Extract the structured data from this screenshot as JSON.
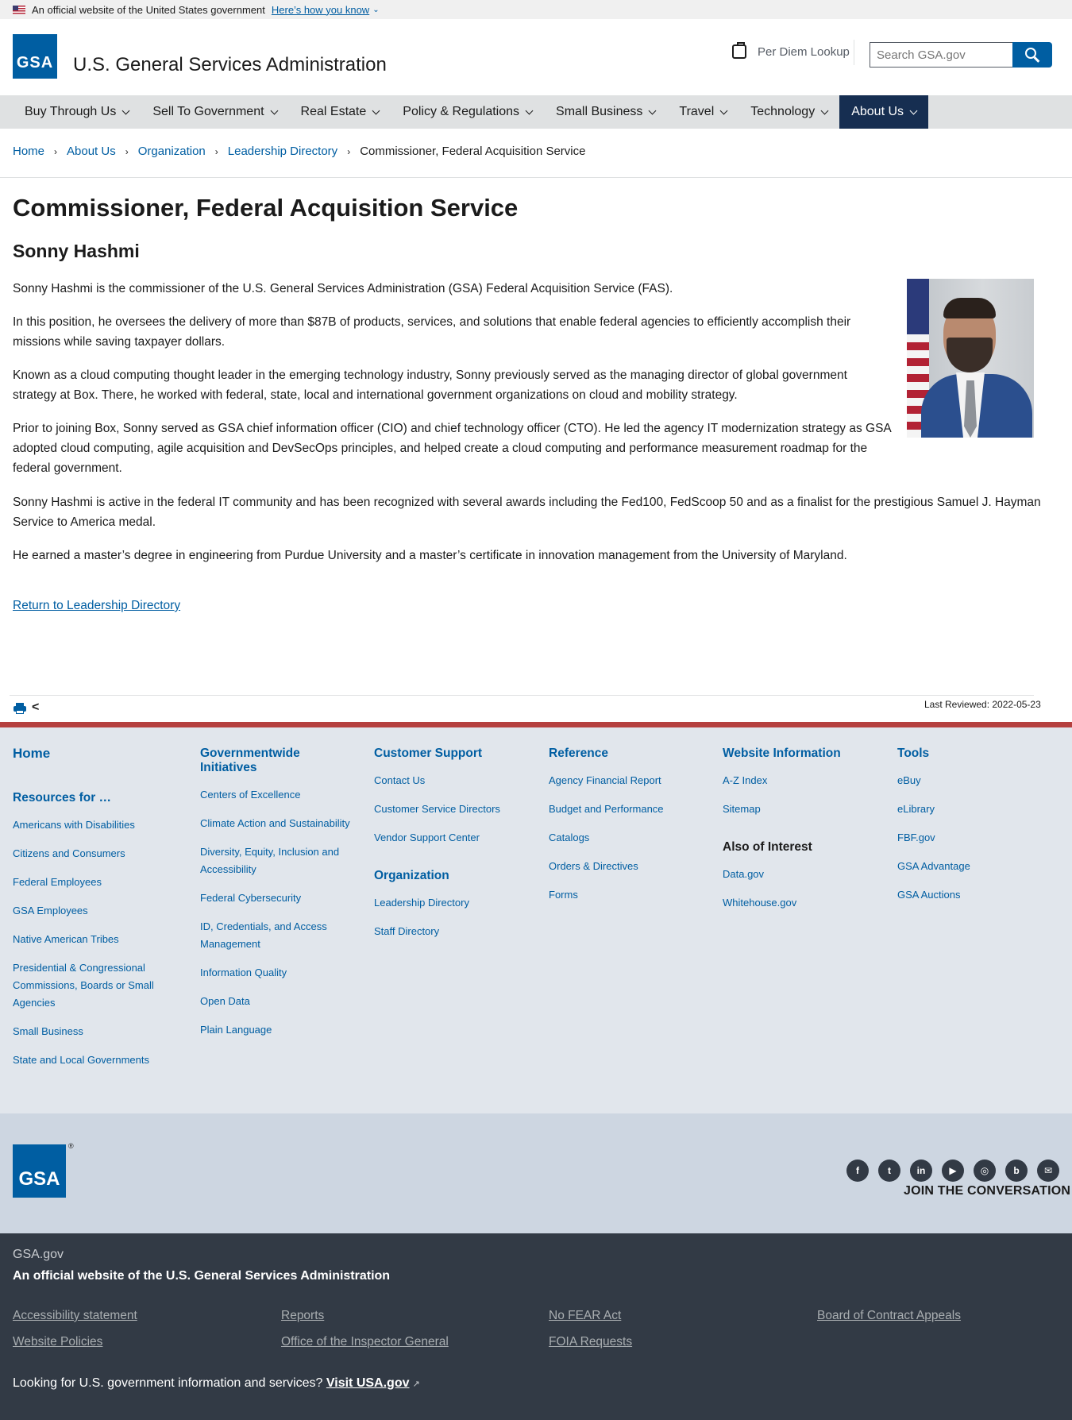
{
  "banner": {
    "text": "An official website of the United States government",
    "how_link": "Here’s how you know"
  },
  "header": {
    "logo": "GSA",
    "title": "U.S. General Services Administration",
    "per_diem": "Per Diem Lookup",
    "search_placeholder": "Search GSA.gov"
  },
  "nav": [
    "Buy Through Us",
    "Sell To Government",
    "Real Estate",
    "Policy & Regulations",
    "Small Business",
    "Travel",
    "Technology",
    "About Us"
  ],
  "breadcrumb": [
    "Home",
    "About Us",
    "Organization",
    "Leadership Directory",
    "Commissioner, Federal Acquisition Service"
  ],
  "page": {
    "title": "Commissioner, Federal Acquisition Service",
    "name": "Sonny Hashmi",
    "bio": [
      "Sonny Hashmi is the commissioner of the U.S. General Services Administration (GSA) Federal Acquisition Service (FAS).",
      "In this position, he oversees the delivery of more than $87B of products, services, and solutions that enable federal agencies to efficiently accomplish their missions while saving taxpayer dollars.",
      "Known as a cloud computing thought leader in the emerging technology industry, Sonny previously served as the managing director of global government strategy at Box. There, he worked with federal, state, local and international government organizations on cloud and mobility strategy.",
      "Prior to joining Box, Sonny served as GSA chief information officer (CIO) and chief technology officer (CTO). He led the agency IT modernization strategy as GSA adopted cloud computing, agile acquisition and DevSecOps principles, and helped create a cloud computing and performance measurement roadmap for the federal government.",
      "Sonny Hashmi is active in the federal IT community and has been recognized with several awards including the Fed100, FedScoop 50 and as a finalist for the prestigious Samuel J. Hayman Service to America medal.",
      "He earned a master’s degree in engineering from Purdue University and a master’s certificate in innovation management from the University of Maryland."
    ],
    "return_link": "Return to Leadership Directory",
    "last_reviewed": "Last Reviewed: 2022-05-23"
  },
  "footer": {
    "col1": {
      "home": "Home",
      "resources_heading": "Resources for …",
      "links": [
        "Americans with Disabilities",
        "Citizens and Consumers",
        "Federal Employees",
        "GSA Employees",
        "Native American Tribes",
        "Presidential & Congressional Commissions, Boards or Small Agencies",
        "Small Business",
        "State and Local Governments"
      ]
    },
    "col2": {
      "heading": "Governmentwide Initiatives",
      "links": [
        "Centers of Excellence",
        "Climate Action and Sustainability",
        "Diversity, Equity, Inclusion and Accessibility",
        "Federal Cybersecurity",
        "ID, Credentials, and Access Management",
        "Information Quality",
        "Open Data",
        "Plain Language"
      ]
    },
    "col3": {
      "heading": "Customer Support",
      "links": [
        "Contact Us",
        "Customer Service Directors",
        "Vendor Support Center"
      ],
      "heading2": "Organization",
      "links2": [
        "Leadership Directory",
        "Staff Directory"
      ]
    },
    "col4": {
      "heading": "Reference",
      "links": [
        "Agency Financial Report",
        "Budget and Performance",
        "Catalogs",
        "Orders & Directives",
        "Forms"
      ]
    },
    "col5": {
      "heading": "Website Information",
      "links": [
        "A-Z Index",
        "Sitemap"
      ],
      "heading2": "Also of Interest",
      "links2": [
        "Data.gov",
        "Whitehouse.gov"
      ]
    },
    "col6": {
      "heading": "Tools",
      "links": [
        "eBuy",
        "eLibrary",
        "FBF.gov",
        "GSA Advantage",
        "GSA Auctions"
      ]
    },
    "logo": "GSA",
    "logo_mark": "®",
    "join": "JOIN THE CONVERSATION",
    "social_icons": [
      "facebook-icon",
      "twitter-icon",
      "linkedin-icon",
      "youtube-icon",
      "instagram-icon",
      "blog-icon",
      "email-icon"
    ],
    "site": "GSA.gov",
    "official": "An official website of the U.S. General Services Administration",
    "bottom_links": [
      "Accessibility statement",
      "Reports",
      "No FEAR Act",
      "Board of Contract Appeals",
      "Website Policies",
      "Office of the Inspector General",
      "FOIA Requests"
    ],
    "looking": "Looking for U.S. government information and services?",
    "visit": "Visit USA.gov"
  },
  "colors": {
    "primary": "#005ea2",
    "nav_active": "#162e51",
    "accent_red": "#b5403f",
    "footer_dark": "#323a45"
  }
}
